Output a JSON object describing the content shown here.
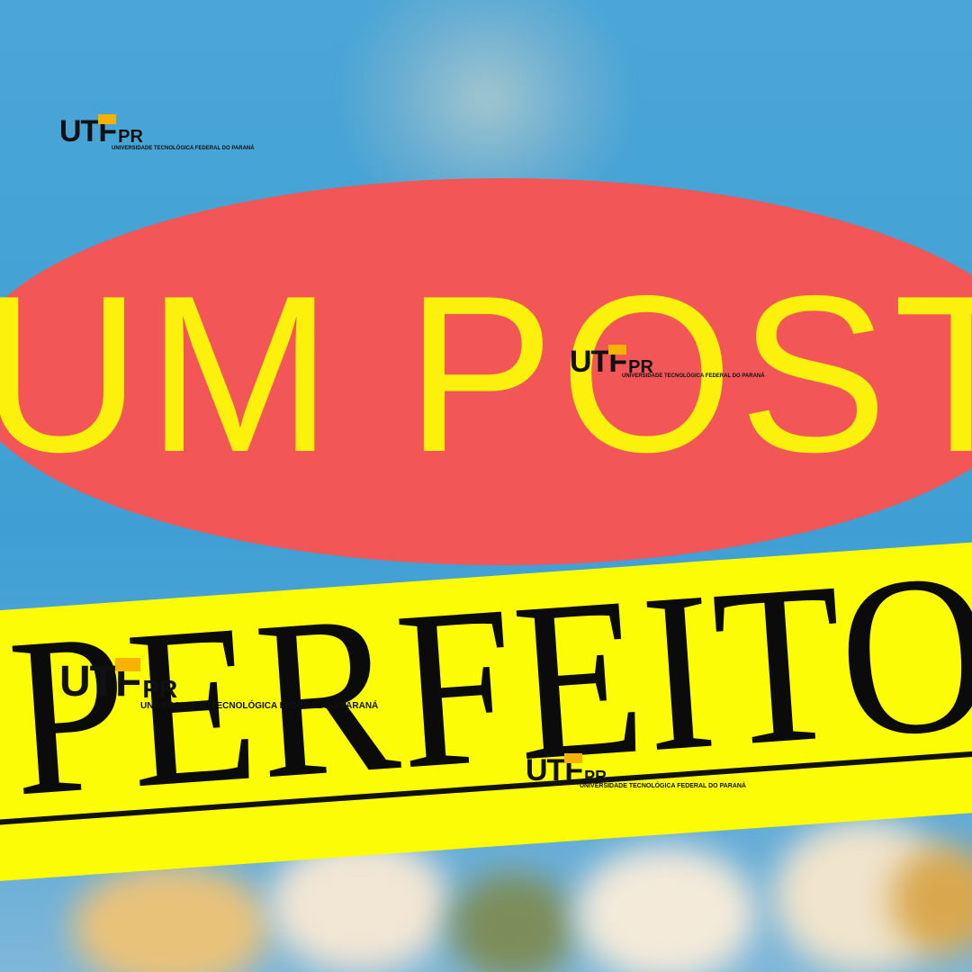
{
  "headline": {
    "line1": "UM POST",
    "line2": "PERFEITO"
  },
  "logo": {
    "mark": "UT",
    "mark_f": "F",
    "pr": "PR",
    "subtitle": "UNIVERSIDADE TECNOLÓGICA FEDERAL DO PARANÁ"
  },
  "colors": {
    "sky": "#4aa6d6",
    "oval": "#f25656",
    "headline_top": "#fbf10d",
    "band": "#fdfc07",
    "headline_bottom": "#0b0b0b",
    "logo_accent": "#f5b300"
  }
}
